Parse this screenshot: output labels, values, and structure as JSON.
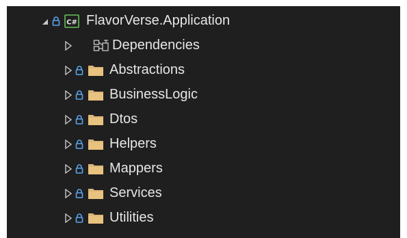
{
  "project": {
    "name": "FlavorVerse.Application",
    "icon": "csharp-project-icon",
    "expanded": true
  },
  "dependencies": {
    "label": "Dependencies",
    "icon": "dependencies-icon"
  },
  "folders": [
    {
      "label": "Abstractions"
    },
    {
      "label": "BusinessLogic"
    },
    {
      "label": "Dtos"
    },
    {
      "label": "Helpers"
    },
    {
      "label": "Mappers"
    },
    {
      "label": "Services"
    },
    {
      "label": "Utilities"
    }
  ],
  "colors": {
    "background": "#1f1f1f",
    "text": "#e6e6e6",
    "lock": "#5aa6f0",
    "folder": "#dcb67a",
    "project": "#68c05a",
    "expander": "#c8c8c8"
  }
}
